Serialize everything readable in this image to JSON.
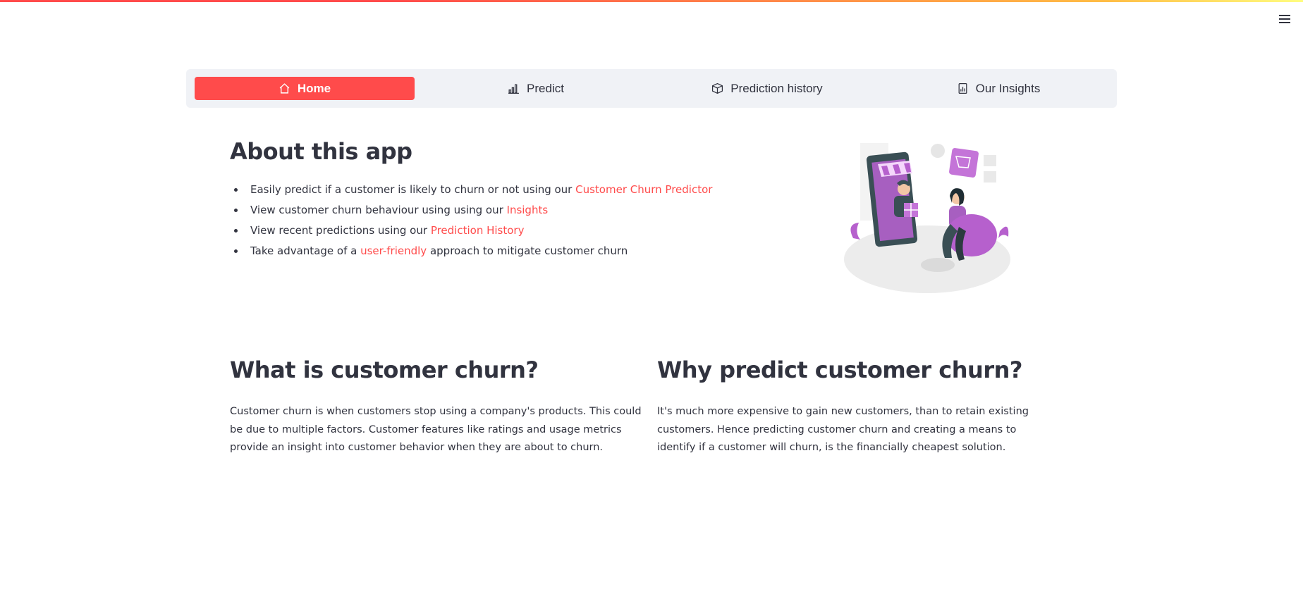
{
  "nav": {
    "items": [
      {
        "label": "Home",
        "icon": "home-icon",
        "active": true
      },
      {
        "label": "Predict",
        "icon": "bar-chart-icon",
        "active": false
      },
      {
        "label": "Prediction history",
        "icon": "box-icon",
        "active": false
      },
      {
        "label": "Our Insights",
        "icon": "report-icon",
        "active": false
      }
    ]
  },
  "about": {
    "title": "About this app",
    "items": [
      {
        "prefix": "Easily predict if a customer is likely to churn or not using our ",
        "link": "Customer Churn Predictor",
        "suffix": ""
      },
      {
        "prefix": "View customer churn behaviour using using our ",
        "link": "Insights",
        "suffix": ""
      },
      {
        "prefix": "View recent predictions using our ",
        "link": "Prediction History",
        "suffix": ""
      },
      {
        "prefix": "Take advantage of a ",
        "link": "user-friendly",
        "suffix": " approach to mitigate customer churn"
      }
    ]
  },
  "what_churn": {
    "title": "What is customer churn?",
    "body": "Customer churn is when customers stop using a company's products. This could be due to multiple factors. Customer features like ratings and usage metrics provide an insight into customer behavior when they are about to churn."
  },
  "why_predict": {
    "title": "Why predict customer churn?",
    "body": "It's much more expensive to gain new customers, than to retain existing customers. Hence predicting customer churn and creating a means to identify if a customer will churn, is the financially cheapest solution."
  },
  "colors": {
    "accent": "#ff4b4b",
    "nav_bg": "#f0f2f6",
    "text": "#31333f",
    "illustration_purple": "#b660cd"
  }
}
